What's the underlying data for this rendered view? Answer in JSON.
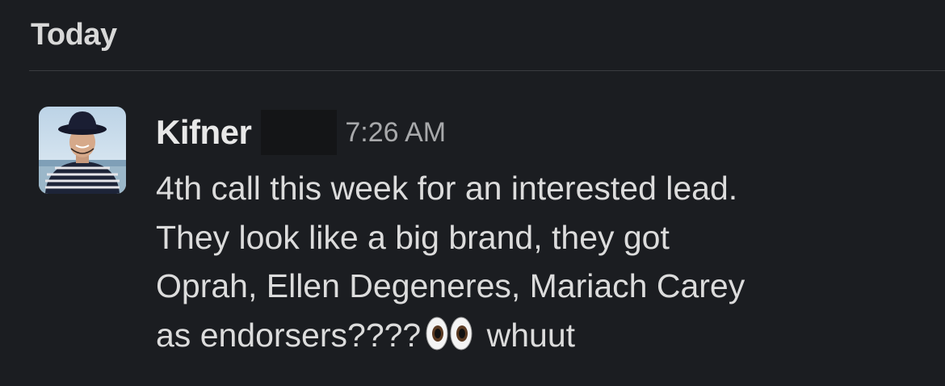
{
  "channel": {
    "day_label": "Today"
  },
  "message": {
    "author": "Kifner",
    "timestamp": "7:26 AM",
    "lines": [
      "4th call this week for an interested lead.",
      "They look like a big brand, they got",
      "Oprah, Ellen Degeneres, Mariach Carey",
      "as endorsers????"
    ],
    "emoji": "eyes-emoji",
    "trailing_text": "whuut"
  }
}
